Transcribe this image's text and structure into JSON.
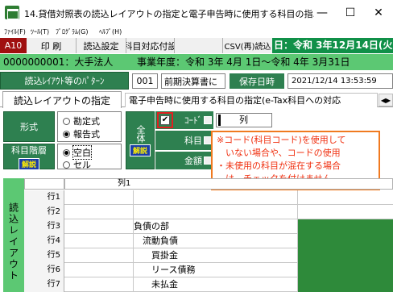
{
  "window": {
    "title": "14.貸借対照表の読込レイアウトの指定と電子申告時に使用する科目の指...",
    "minimize": "—",
    "maximize": "☐",
    "close": "✕"
  },
  "menu": [
    "ﾌｧｲﾙ(F)",
    "ﾂｰﾙ(T)",
    "ﾌﾟﾛｸﾞﾗﾑ(G)",
    "ﾍﾙﾌﾟ(H)"
  ],
  "toolbar": {
    "screen_code": "A10",
    "print": "印 刷",
    "read_settings": "読込設定",
    "subject_mapping": "科目対応付設",
    "csv_read": "CSV(再)読込",
    "date_banner": "日：令和 3年12月14日(火)"
  },
  "company": {
    "name": "0000000001：大手法人",
    "fiscal_year": "事業年度：令和 3年 4月 1日～令和 4年 3月31日"
  },
  "pattern": {
    "label": "読込ﾚｲｱｳﾄ等のﾊﾟﾀｰﾝ",
    "number": "001",
    "name": "前期決算書に",
    "save_date_label": "保存日時",
    "save_date": "2021/12/14 13:53:59"
  },
  "tabs": {
    "layout": "読込レイアウトの指定",
    "etax": "電子申告時に使用する科目の指定(e-Tax科目への対応",
    "scroll": "◀▶"
  },
  "settings": {
    "format_label": "形式",
    "format_options": [
      "勘定式",
      "報告式"
    ],
    "format_selected": 1,
    "hierarchy_label": "科目階層",
    "hierarchy_options": [
      "空白",
      "セル"
    ],
    "hierarchy_selected": 0,
    "help": "解説",
    "all_label": "全体",
    "code_label": "ｺｰﾄﾞ",
    "code_checked": "✔",
    "column_suffix": "列",
    "subject_label": "科目",
    "amount_label": "金額"
  },
  "callout": [
    "※コード(科目コード)を使用して",
    "　いない場合や、コードの使用",
    "・未使用の科目が混在する場合",
    "　は、チェックを付けません。"
  ],
  "grid": {
    "column_header": "列1",
    "side_label": "読込レイアウト",
    "rows": [
      {
        "label": "行1",
        "text": "",
        "green": false
      },
      {
        "label": "行2",
        "text": "",
        "green": false
      },
      {
        "label": "行3",
        "text": "負債の部",
        "green": true
      },
      {
        "label": "行4",
        "text": "　流動負債",
        "green": true
      },
      {
        "label": "行5",
        "text": "　　買掛金",
        "green": true
      },
      {
        "label": "行6",
        "text": "　　リース債務",
        "green": true
      },
      {
        "label": "行7",
        "text": "　　未払金",
        "green": true
      }
    ]
  }
}
